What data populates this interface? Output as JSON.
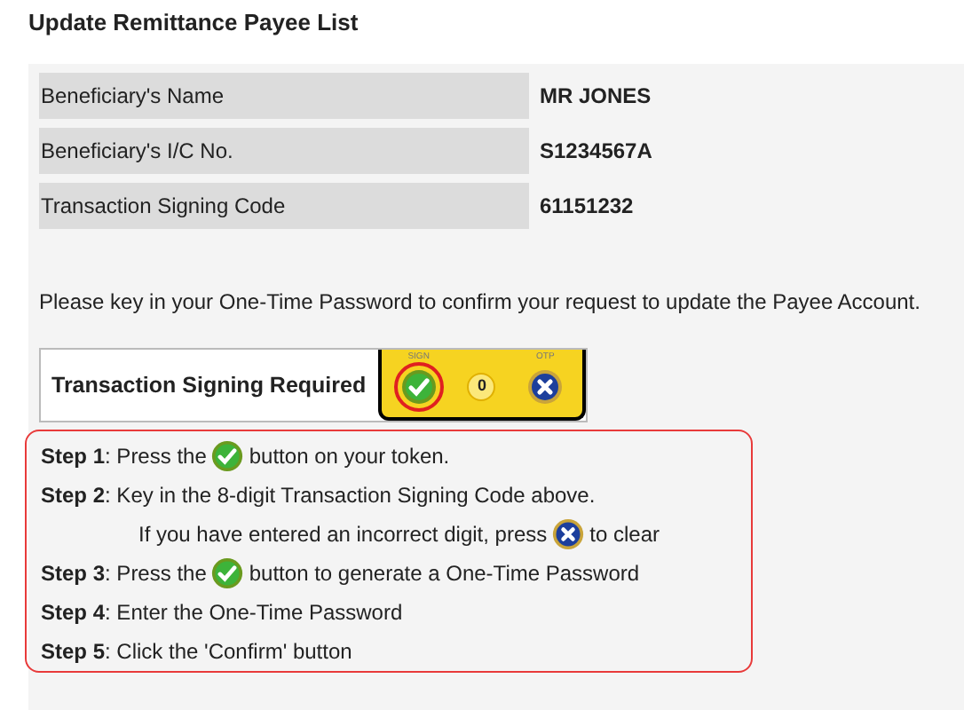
{
  "title": "Update Remittance Payee List",
  "details": [
    {
      "label": "Beneficiary's Name",
      "value": "MR JONES"
    },
    {
      "label": "Beneficiary's I/C No.",
      "value": "S1234567A"
    },
    {
      "label": "Transaction Signing Code",
      "value": "61151232"
    }
  ],
  "instruction": "Please key in your One-Time Password to confirm your request to update the Payee Account.",
  "signing": {
    "label": "Transaction Signing Required",
    "token": {
      "sign_label": "SIGN",
      "zero_key": "0",
      "otp_label": "OTP",
      "highlighted": true
    }
  },
  "steps": [
    {
      "lines": [
        [
          {
            "kind": "text",
            "text": "**Step 1**: Press the"
          },
          {
            "kind": "check"
          },
          {
            "kind": "text",
            "text": "button on your token."
          }
        ]
      ]
    },
    {
      "lines": [
        [
          {
            "kind": "text",
            "text": "**Step 2**: Key in the 8-digit Transaction Signing Code above."
          }
        ],
        [
          {
            "kind": "text",
            "text": "If you have entered an incorrect digit, press"
          },
          {
            "kind": "clear"
          },
          {
            "kind": "text",
            "text": "to clear"
          }
        ]
      ]
    },
    {
      "lines": [
        [
          {
            "kind": "text",
            "text": "**Step 3**: Press the"
          },
          {
            "kind": "check"
          },
          {
            "kind": "text",
            "text": "button to generate a One-Time Password"
          }
        ]
      ]
    },
    {
      "lines": [
        [
          {
            "kind": "text",
            "text": "**Step 4**: Enter the One-Time Password"
          }
        ]
      ]
    },
    {
      "lines": [
        [
          {
            "kind": "text",
            "text": "**Step 5**: Click the 'Confirm' button"
          }
        ]
      ]
    }
  ]
}
